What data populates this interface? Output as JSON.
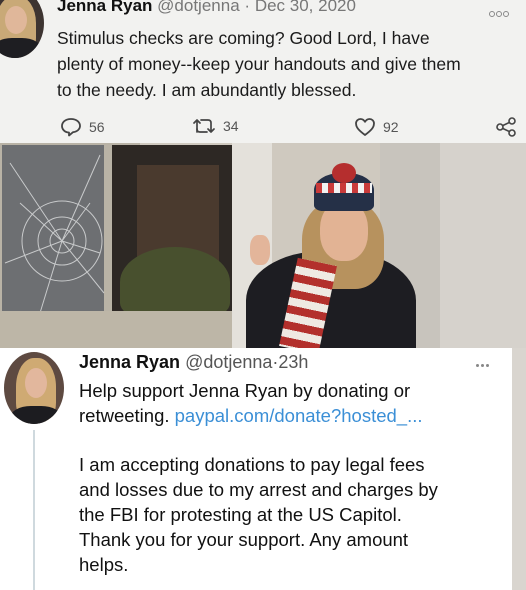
{
  "tweet_top": {
    "name": "Jenna Ryan",
    "handle": "@dotjenna",
    "separator": "·",
    "date": "Dec 30, 2020",
    "lines": [
      "Stimulus checks are coming? Good Lord, I have",
      "plenty of money--keep your handouts and give them",
      "to the needy. I am abundantly blessed."
    ],
    "actions": {
      "reply_count": "56",
      "retweet_count": "34",
      "like_count": "92"
    },
    "icons": {
      "more": "more-icon",
      "reply": "reply-icon",
      "retweet": "retweet-icon",
      "like": "heart-icon",
      "share": "share-icon"
    }
  },
  "photo": {
    "subject": "photo-of-woman-at-broken-window"
  },
  "tweet_bottom": {
    "name": "Jenna Ryan",
    "handle": "@dotjenna",
    "separator": "·",
    "time": "23h",
    "line1": "Help support Jenna Ryan by donating or",
    "line2_text": "retweeting. ",
    "line2_link": "paypal.com/donate?hosted_...",
    "para2": [
      "I am accepting donations to pay legal fees",
      "and losses due to my arrest and charges by",
      "the FBI for protesting at the US Capitol.",
      "Thank you for your support. Any amount",
      "helps."
    ],
    "colors": {
      "link": "#3b8fd6"
    }
  }
}
